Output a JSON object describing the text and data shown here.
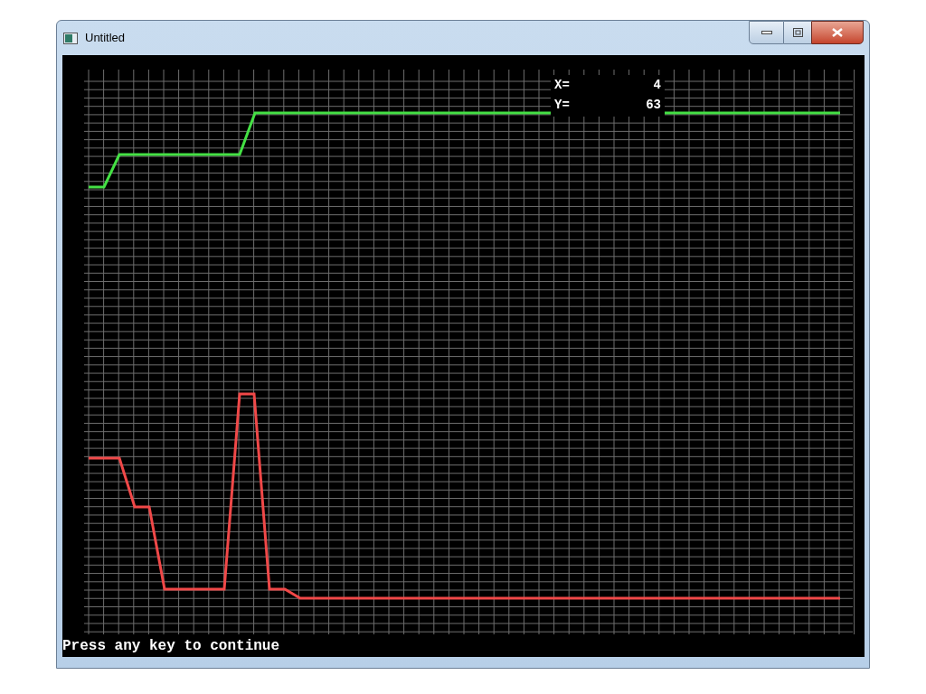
{
  "window": {
    "title": "Untitled"
  },
  "readout": [
    {
      "label": "X=",
      "value": "4"
    },
    {
      "label": "Y=",
      "value": "63"
    }
  ],
  "console_text": "Press any key to continue"
}
